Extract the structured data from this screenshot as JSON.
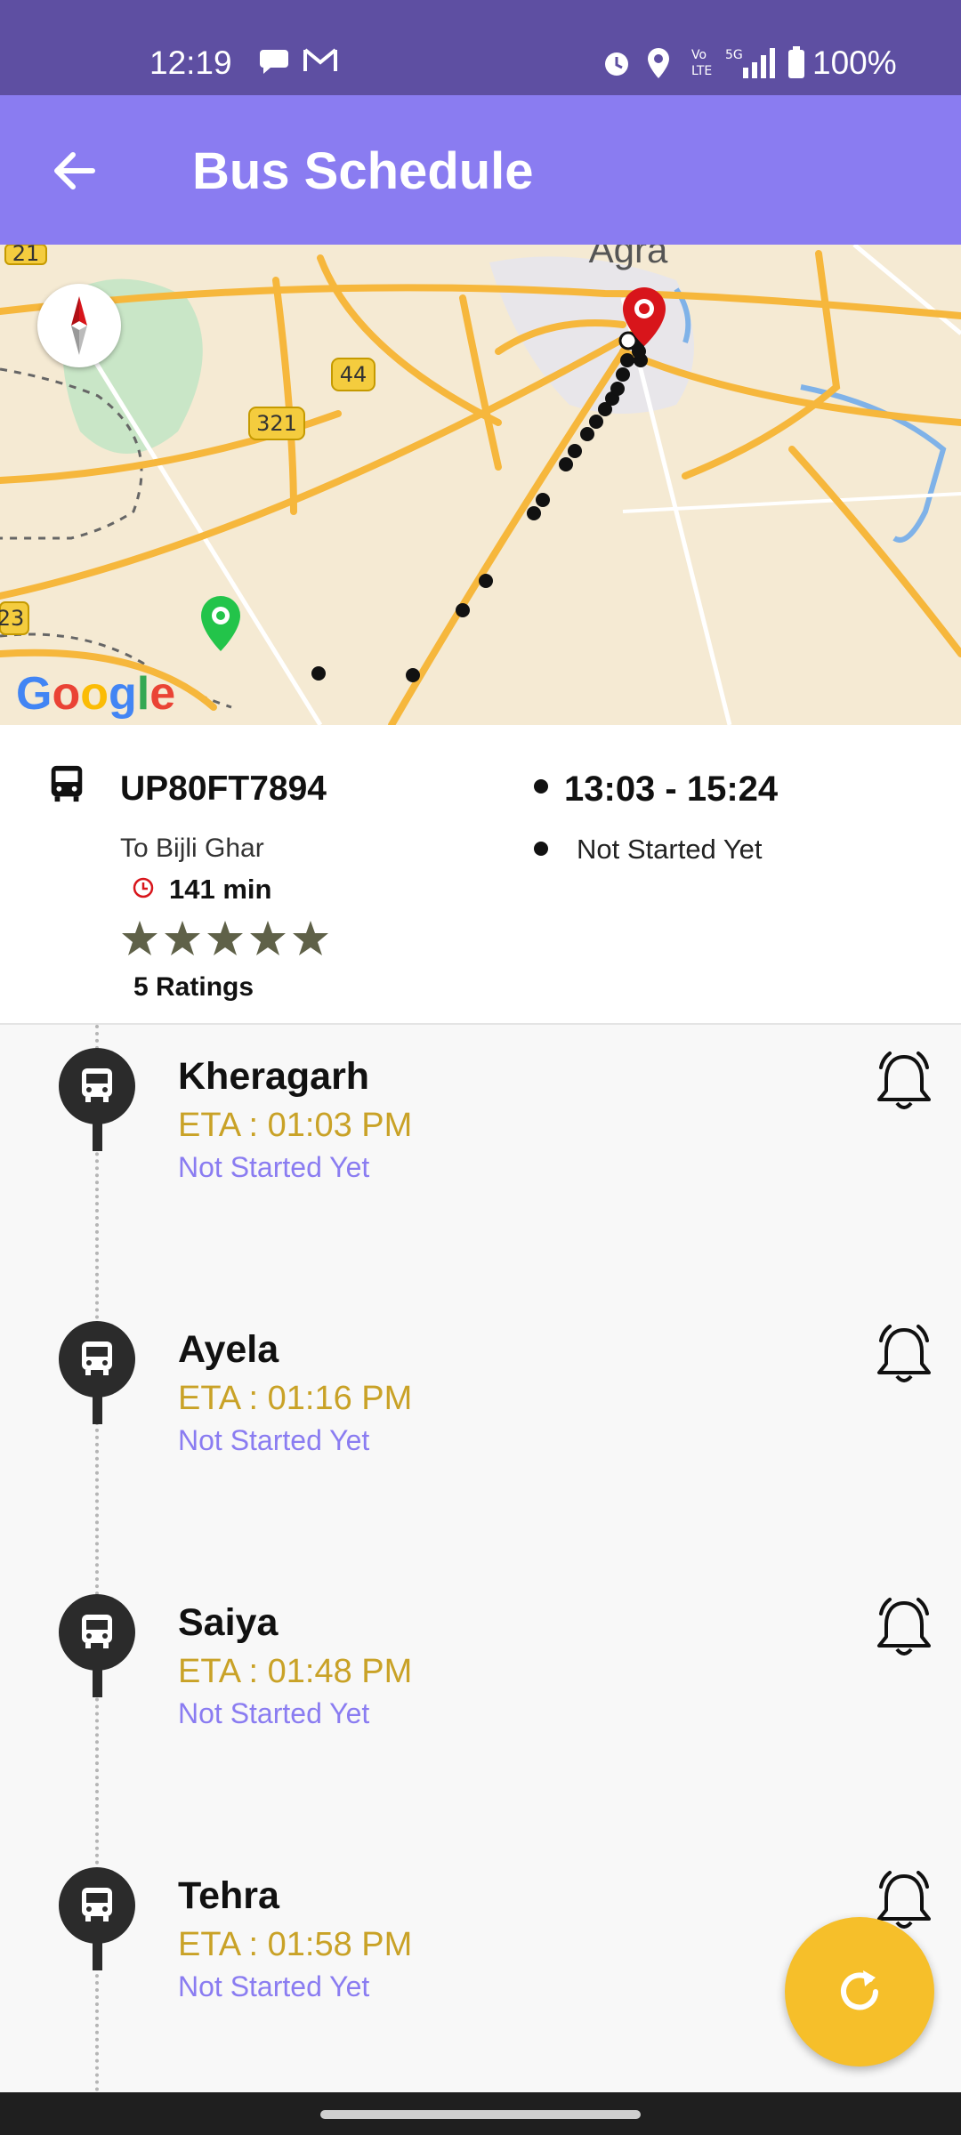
{
  "status_bar": {
    "time": "12:19",
    "battery": "100%",
    "icons": [
      "message-icon",
      "gmail-icon",
      "alarm-icon",
      "location-icon",
      "volte-icon",
      "5g-signal-icon",
      "battery-icon"
    ]
  },
  "app_bar": {
    "title": "Bus Schedule",
    "back_icon": "arrow-left-icon"
  },
  "map": {
    "city_label": "Agra",
    "road_shields": [
      "21",
      "44",
      "321",
      "23"
    ],
    "provider": "Google",
    "compass_icon": "compass-icon",
    "origin_marker": "green-pin-icon",
    "destination_marker": "red-pin-icon"
  },
  "bus_info": {
    "bus_icon": "bus-icon",
    "plate": "UP80FT7894",
    "destination": "To Bijli Ghar",
    "duration": "141 min",
    "rating_stars": 5,
    "ratings_label": "5 Ratings",
    "time_range": "13:03 - 15:24",
    "status": "Not Started Yet"
  },
  "stops": [
    {
      "name": "Kheragarh",
      "eta": "ETA  : 01:03 PM",
      "status": "Not Started Yet"
    },
    {
      "name": "Ayela",
      "eta": "ETA  : 01:16 PM",
      "status": "Not Started Yet"
    },
    {
      "name": "Saiya",
      "eta": "ETA  : 01:48 PM",
      "status": "Not Started Yet"
    },
    {
      "name": "Tehra",
      "eta": "ETA  : 01:58 PM",
      "status": "Not Started Yet"
    }
  ],
  "fab": {
    "icon": "refresh-icon"
  },
  "colors": {
    "status_bar": "#5e4fa2",
    "app_bar": "#8a7cf1",
    "eta_text": "#c9a227",
    "stop_status": "#8a7cf1",
    "fab": "#f6bf2a"
  }
}
